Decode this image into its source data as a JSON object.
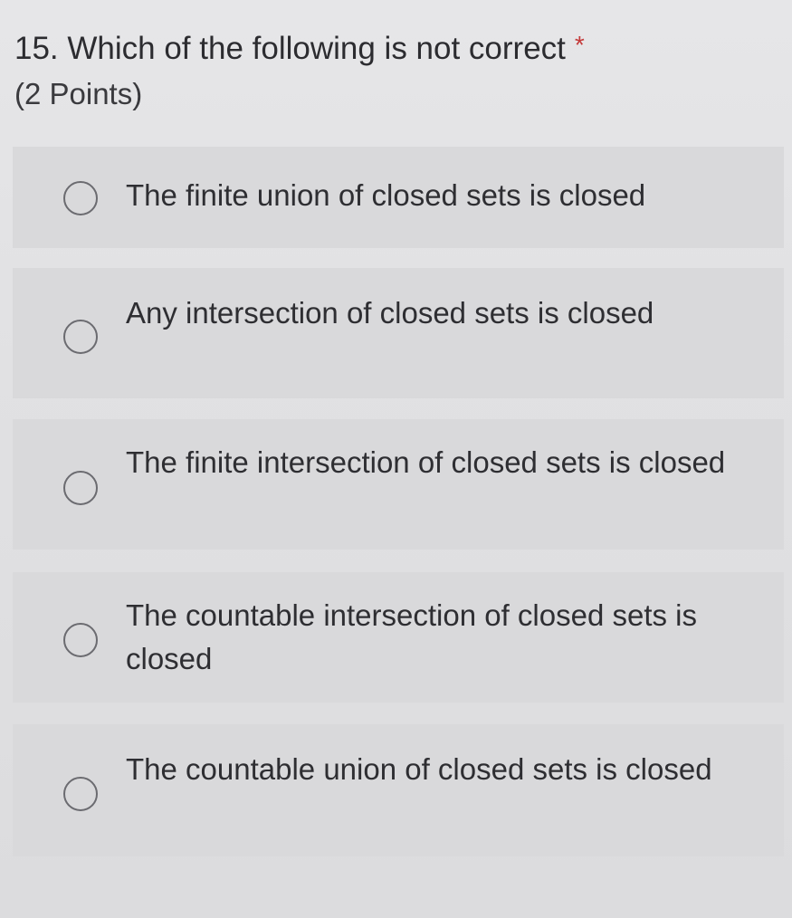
{
  "question": {
    "number_and_text": "15. Which of the following is not correct",
    "required_marker": "*",
    "points": "(2 Points)"
  },
  "options": [
    {
      "label": "The finite union of closed sets is closed"
    },
    {
      "label": "Any intersection of closed sets is closed"
    },
    {
      "label": "The finite intersection of closed sets is closed"
    },
    {
      "label": "The countable intersection of closed sets is closed"
    },
    {
      "label": "The countable union of closed sets is closed"
    }
  ],
  "colors": {
    "background": "#e3e3e5",
    "option_background": "#d9d9db",
    "required_marker": "#c43a3a",
    "radio_border": "#6b6b70"
  }
}
